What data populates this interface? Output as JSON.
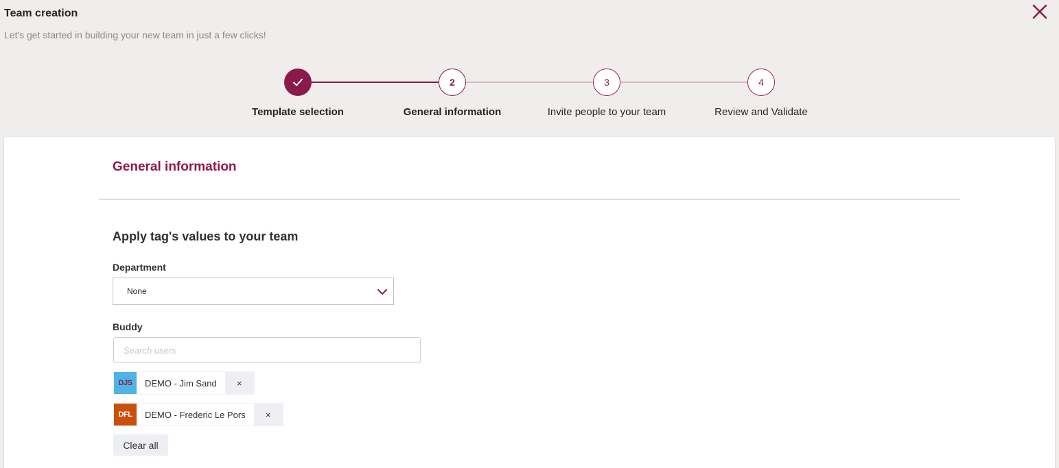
{
  "header": {
    "title": "Team creation",
    "subtitle": "Let's get started in building your new team in just a few clicks!",
    "close_icon": "close-icon"
  },
  "stepper": {
    "steps": [
      {
        "number": "1",
        "label": "Template selection",
        "state": "done"
      },
      {
        "number": "2",
        "label": "General information",
        "state": "active"
      },
      {
        "number": "3",
        "label": "Invite people to your team",
        "state": "pending"
      },
      {
        "number": "4",
        "label": "Review and Validate",
        "state": "pending"
      }
    ]
  },
  "card": {
    "title": "General information",
    "section_title": "Apply tag's values to your team",
    "department": {
      "label": "Department",
      "value": "None"
    },
    "buddy": {
      "label": "Buddy",
      "placeholder": "Search users",
      "selected": [
        {
          "initials": "DJS",
          "name": "DEMO - Jim Sand",
          "avatar_bg": "#4fb3e8",
          "avatar_fg": "#8b1a4a"
        },
        {
          "initials": "DFL",
          "name": "DEMO - Frederic Le Pors",
          "avatar_bg": "#c94f0c",
          "avatar_fg": "#ffffff"
        }
      ],
      "remove_symbol": "×",
      "clear_all_label": "Clear all"
    }
  },
  "colors": {
    "accent": "#8b1a4a",
    "background": "#f0eeed"
  }
}
